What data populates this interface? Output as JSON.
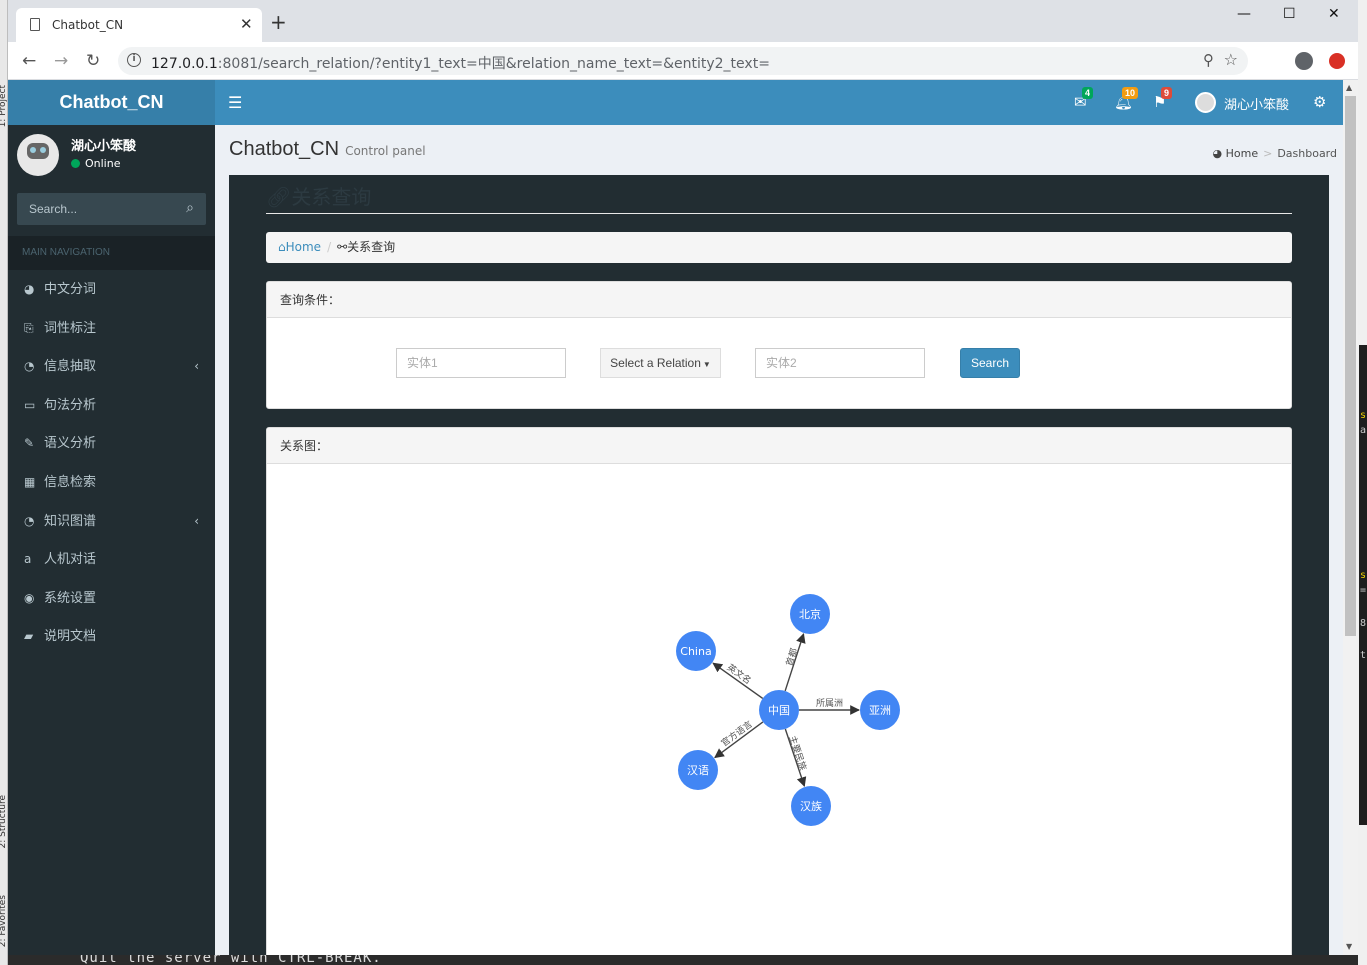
{
  "browser": {
    "tab_title": "Chatbot_CN",
    "url_host": "127.0.0.1",
    "url_rest": ":8081/search_relation/?entity1_text=中国&relation_name_text=&entity2_text="
  },
  "desktop": {
    "ide_labels": [
      "1: Project",
      "2: Structure",
      "2: Favorites"
    ],
    "terminal_line": "Quit the server with CTRL-BREAK.",
    "terminal_chars": [
      "s",
      "a",
      "s",
      "=",
      "8",
      "t"
    ]
  },
  "header": {
    "logo": "Chatbot_CN",
    "messages_count": "4",
    "notifications_count": "10",
    "tasks_count": "9",
    "user_name": "湖心小笨酸",
    "colors": {
      "primary": "#3c8dbc",
      "logo_bg": "#367fa9",
      "sidebar": "#222d32"
    }
  },
  "sidebar": {
    "user_name": "湖心小笨酸",
    "status": "Online",
    "search_placeholder": "Search...",
    "nav_header": "MAIN NAVIGATION",
    "items": [
      {
        "label": "中文分词",
        "icon": "dashboard-icon",
        "has_children": false
      },
      {
        "label": "词性标注",
        "icon": "clipboard-icon",
        "has_children": false
      },
      {
        "label": "信息抽取",
        "icon": "pie-chart-icon",
        "has_children": true
      },
      {
        "label": "句法分析",
        "icon": "laptop-icon",
        "has_children": false
      },
      {
        "label": "语义分析",
        "icon": "edit-icon",
        "has_children": false
      },
      {
        "label": "信息检索",
        "icon": "table-icon",
        "has_children": false
      },
      {
        "label": "知识图谱",
        "icon": "pie-chart-icon",
        "has_children": true
      },
      {
        "label": "人机对话",
        "icon": "amazon-icon",
        "has_children": false
      },
      {
        "label": "系统设置",
        "icon": "compass-icon",
        "has_children": false
      },
      {
        "label": "说明文档",
        "icon": "book-icon",
        "has_children": false
      }
    ]
  },
  "content": {
    "title": "Chatbot_CN",
    "subtitle": "Control panel",
    "crumb_home": "Home",
    "crumb_current": "Dashboard",
    "box_title": "关系查询",
    "breadcrumb_home": "Home",
    "breadcrumb_current": "关系查询"
  },
  "query": {
    "heading": "查询条件：",
    "entity1_placeholder": "实体1",
    "relation_label": "Select a Relation",
    "entity2_placeholder": "实体2",
    "search_label": "Search"
  },
  "graph": {
    "heading": "关系图：",
    "node_color": "#4286f4",
    "center": "中国",
    "edges": [
      {
        "target": "北京",
        "relation": "首都"
      },
      {
        "target": "China",
        "relation": "英文名"
      },
      {
        "target": "亚洲",
        "relation": "所属洲"
      },
      {
        "target": "汉语",
        "relation": "官方语言"
      },
      {
        "target": "汉族",
        "relation": "主要民族"
      }
    ]
  }
}
